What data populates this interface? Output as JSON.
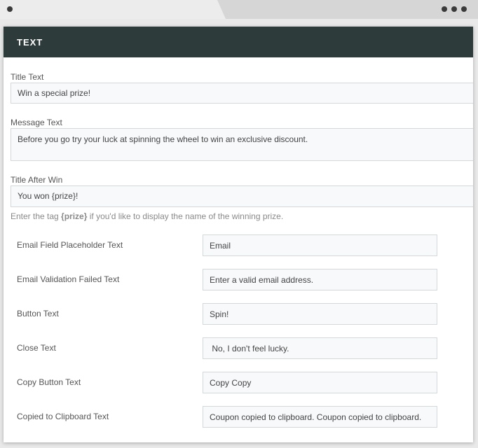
{
  "panel": {
    "title": "TEXT"
  },
  "fields": {
    "title_text": {
      "label": "Title Text",
      "value": "Win a special prize!"
    },
    "message_text": {
      "label": "Message Text",
      "value": "Before you go try your luck at spinning the wheel to win an exclusive discount."
    },
    "title_after_win": {
      "label": "Title After Win",
      "value": "You won {prize}!"
    }
  },
  "hint": {
    "before": "Enter the tag ",
    "tag": "{prize}",
    "after": " if you'd like to display the name of the winning prize."
  },
  "rows": [
    {
      "label": "Email Field Placeholder Text",
      "value": "Email"
    },
    {
      "label": "Email Validation Failed Text",
      "value": "Enter a valid email address."
    },
    {
      "label": "Button Text",
      "value": "Spin!"
    },
    {
      "label": "Close Text",
      "value": " No, I don't feel lucky."
    },
    {
      "label": "Copy Button Text",
      "value": "Copy Copy"
    },
    {
      "label": "Copied to Clipboard Text",
      "value": "Coupon copied to clipboard. Coupon copied to clipboard."
    }
  ]
}
